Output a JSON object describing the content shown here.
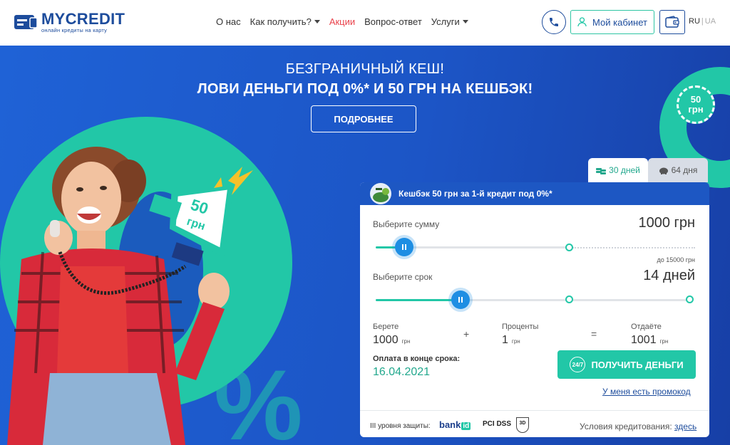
{
  "header": {
    "logo_title": "MYCREDIT",
    "logo_subtitle": "онлайн кредиты на карту",
    "nav": [
      {
        "label": "О нас",
        "dropdown": false
      },
      {
        "label": "Как получить?",
        "dropdown": true
      },
      {
        "label": "Акции",
        "dropdown": false,
        "highlight": "#e9424b"
      },
      {
        "label": "Вопрос-ответ",
        "dropdown": false
      },
      {
        "label": "Услуги",
        "dropdown": true
      }
    ],
    "cabinet_label": "Мой кабинет",
    "lang_active": "RU",
    "lang_separator": "|",
    "lang_other": "UA"
  },
  "hero": {
    "line1": "БЕЗГРАНИЧНЫЙ КЕШ!",
    "line2": "ЛОВИ ДЕНЬГИ ПОД 0%* И 50 ГРН НА КЕШБЭК!",
    "more_button": "ПОДРОБНЕЕ",
    "megaphone_text_top": "50",
    "megaphone_text_bottom": "грн",
    "badge_top": "50",
    "badge_bottom": "грн",
    "percent_glyph": "%"
  },
  "calculator": {
    "tabs": [
      {
        "label": "30 дней",
        "active": true
      },
      {
        "label": "64 дня",
        "active": false
      }
    ],
    "cashback_text": "Кешбэк 50 грн за 1-й кредит под 0%*",
    "amount_label": "Выберите сумму",
    "amount_value": "1000 грн",
    "amount_max_note": "до 15000 грн",
    "amount_fraction": 0.066,
    "term_label": "Выберите срок",
    "term_value": "14 дней",
    "term_fraction": 0.27,
    "take_label": "Берете",
    "take_value": "1000",
    "interest_label": "Проценты",
    "interest_value": "1",
    "give_label": "Отдаёте",
    "give_value": "1001",
    "currency": "грн",
    "plus": "+",
    "equals": "=",
    "pay_label": "Оплата в конце срока:",
    "pay_date": "16.04.2021",
    "get_button": "ПОЛУЧИТЬ ДЕНЬГИ",
    "badge_247": "24/7",
    "promo_link": "У меня есть промокод",
    "security_label": "III уровня защиты:",
    "bankid_text": "bank",
    "bankid_suffix": "id",
    "pci_text": "PCI DSS",
    "secure3d_text": "3D",
    "terms_label": "Условия кредитования:",
    "terms_link": "здесь"
  },
  "colors": {
    "brand_blue": "#1d4c9c",
    "accent_green": "#22c7a7",
    "hero_blue": "#1f62d6",
    "slider_blue": "#1e8ee3",
    "promo_red": "#e9424b"
  }
}
